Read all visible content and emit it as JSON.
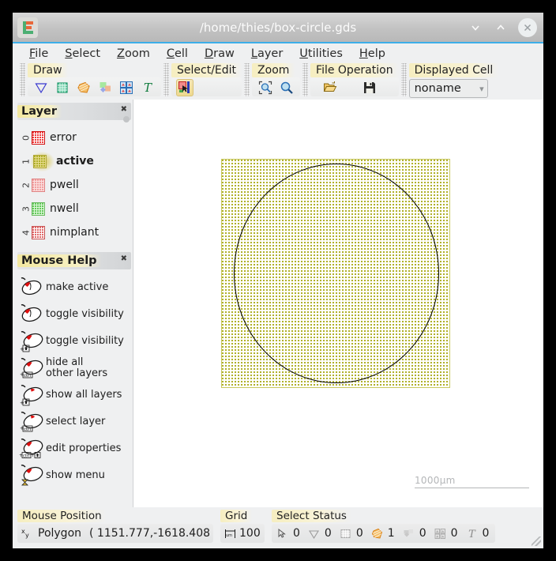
{
  "window": {
    "title": "/home/thies/box-circle.gds",
    "logo_icon": "app-logo-icon",
    "minimize_icon": "chevron-down-icon",
    "maximize_icon": "chevron-up-icon",
    "close_icon": "close-icon",
    "accent_color": "#3daee9"
  },
  "menubar": {
    "items": [
      {
        "label": "File",
        "mnemonic": "F"
      },
      {
        "label": "Select",
        "mnemonic": "S"
      },
      {
        "label": "Zoom",
        "mnemonic": "Z"
      },
      {
        "label": "Cell",
        "mnemonic": "C"
      },
      {
        "label": "Draw",
        "mnemonic": "D"
      },
      {
        "label": "Layer",
        "mnemonic": "L"
      },
      {
        "label": "Utilities",
        "mnemonic": "U"
      },
      {
        "label": "Help",
        "mnemonic": "H"
      }
    ]
  },
  "toolbar": {
    "groups": [
      {
        "title": "Draw",
        "tools": [
          {
            "icon": "wedge-tool-icon",
            "pressed": false
          },
          {
            "icon": "box-tool-icon",
            "pressed": false
          },
          {
            "icon": "polygon-tool-icon",
            "pressed": false
          },
          {
            "icon": "path-tool-icon",
            "pressed": false
          },
          {
            "icon": "array-tool-icon",
            "pressed": false
          },
          {
            "icon": "text-tool-icon",
            "pressed": false
          }
        ]
      },
      {
        "title": "Select/Edit",
        "tools": [
          {
            "icon": "select-edit-icon",
            "pressed": true
          }
        ]
      },
      {
        "title": "Zoom",
        "tools": [
          {
            "icon": "zoom-fit-icon",
            "pressed": false
          },
          {
            "icon": "zoom-glass-icon",
            "pressed": false
          }
        ]
      },
      {
        "title": "File Operation",
        "tools": [
          {
            "icon": "open-folder-icon",
            "pressed": false
          },
          {
            "icon": "save-disk-icon",
            "pressed": false
          }
        ]
      }
    ],
    "displayed_cell": {
      "title": "Displayed Cell",
      "value": "noname",
      "arrow_icon": "chevron-down-icon"
    }
  },
  "sidebar": {
    "layer_panel": {
      "title": "Layer",
      "close_icon": "close-icon",
      "layers": [
        {
          "num": "0",
          "name": "error",
          "color": "#ef3b3b",
          "active": false
        },
        {
          "num": "1",
          "name": "active",
          "color": "#d8c94a",
          "active": true
        },
        {
          "num": "2",
          "name": "pwell",
          "color": "#f0a0a0",
          "active": false
        },
        {
          "num": "3",
          "name": "nwell",
          "color": "#a8e8a0",
          "active": false
        },
        {
          "num": "4",
          "name": "nimplant",
          "color": "#e88a8a",
          "active": false
        }
      ]
    },
    "mouse_help_panel": {
      "title": "Mouse Help",
      "close_icon": "close-icon",
      "entries": [
        {
          "label": "make active",
          "button": "left",
          "modifier": ""
        },
        {
          "label": "toggle visibility",
          "button": "left",
          "modifier": ""
        },
        {
          "label": "toggle visibility",
          "button": "left",
          "modifier": "shift"
        },
        {
          "label": "hide all other layers",
          "button": "left",
          "modifier": "ctrl"
        },
        {
          "label": "show all layers",
          "button": "middle",
          "modifier": "shift"
        },
        {
          "label": "select layer",
          "button": "middle",
          "modifier": "ctrl"
        },
        {
          "label": "edit properties",
          "button": "left",
          "modifier": "ctrl+shift"
        },
        {
          "label": "show menu",
          "button": "left",
          "modifier": "hourglass"
        }
      ]
    }
  },
  "canvas": {
    "scale_bar": "1000µm",
    "shapes": [
      {
        "name": "box",
        "layer": "active",
        "fill": "#b0b02a"
      },
      {
        "name": "circle",
        "stroke": "#000000"
      }
    ]
  },
  "statusbar": {
    "mouse_position": {
      "title": "Mouse Position",
      "icon": "xy-coordinate-icon",
      "object": "Polygon",
      "coords": "( 1151.777,-1618.408"
    },
    "grid": {
      "title": "Grid",
      "icon": "grid-measure-icon",
      "value": "100"
    },
    "select_status": {
      "title": "Select Status",
      "counters": [
        {
          "icon": "pointer-icon",
          "count": "0"
        },
        {
          "icon": "wedge-icon",
          "count": "0"
        },
        {
          "icon": "box-icon",
          "count": "0"
        },
        {
          "icon": "polygon-icon",
          "count": "1"
        },
        {
          "icon": "path-icon",
          "count": "0"
        },
        {
          "icon": "array-icon",
          "count": "0"
        },
        {
          "icon": "text-icon",
          "count": "0"
        }
      ]
    },
    "resize_grip_icon": "resize-grip-icon"
  }
}
